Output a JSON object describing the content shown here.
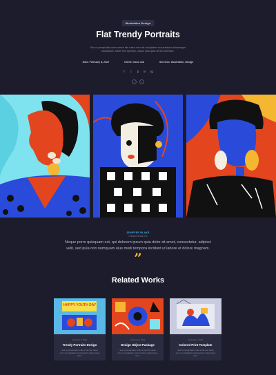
{
  "header": {
    "badge": "Illustration Design",
    "title": "Flat Trendy Portraits",
    "subtitle": "Sed ut perspiciatis unde omnis iste natus error sit voluptatem accusantium doloremque laudantium, totam rem aperiam, eaque ipsa quae ab illo inventore."
  },
  "meta": {
    "date": "Date: February 8, 2022",
    "client": "Client: Good Job",
    "services": "Services: Illustration, Design"
  },
  "social": [
    "f",
    "t",
    "p",
    "in",
    "tg"
  ],
  "arrows": {
    "prev": "‹",
    "next": "›"
  },
  "colors": {
    "background": "#1c1c2c",
    "card": "#2a2b3f",
    "accent_blue": "#3fb1e8",
    "accent_yellow": "#f5b731",
    "portrait_red": "#e3451f",
    "portrait_blue": "#2a4bd9",
    "portrait_cyan": "#7fe3ef"
  },
  "quote": {
    "author": "JENIFFER BLAKE",
    "role": "Creative Studio Inc",
    "text": "Neque porro quisquam est, qui dolorem ipsum quia dolor sit amet, consectetur, adipisci velit, sed quia non numquam eius modi tempora incidunt ut labore et dolore magnam.",
    "mark": "”"
  },
  "related": {
    "title": "Related Works",
    "items": [
      {
        "date": "February 8, 2022",
        "title": "Trendy Portraits Design",
        "desc": "Sed ut perspiciatis unde omnis iste natus error sit voluptatem accusantium doloremque laud."
      },
      {
        "date": "February 8, 2022",
        "title": "Design Object Package",
        "desc": "Sed ut perspiciatis unde omnis iste natus error sit voluptatem accusantium doloremque laud."
      },
      {
        "date": "February 8, 2022",
        "title": "Colored Print Template",
        "desc": "Sed ut perspiciatis unde omnis iste natus error sit voluptatem accusantium doloremque laud."
      }
    ],
    "thumb1_text": "HAPPY YOUTH DAY"
  }
}
